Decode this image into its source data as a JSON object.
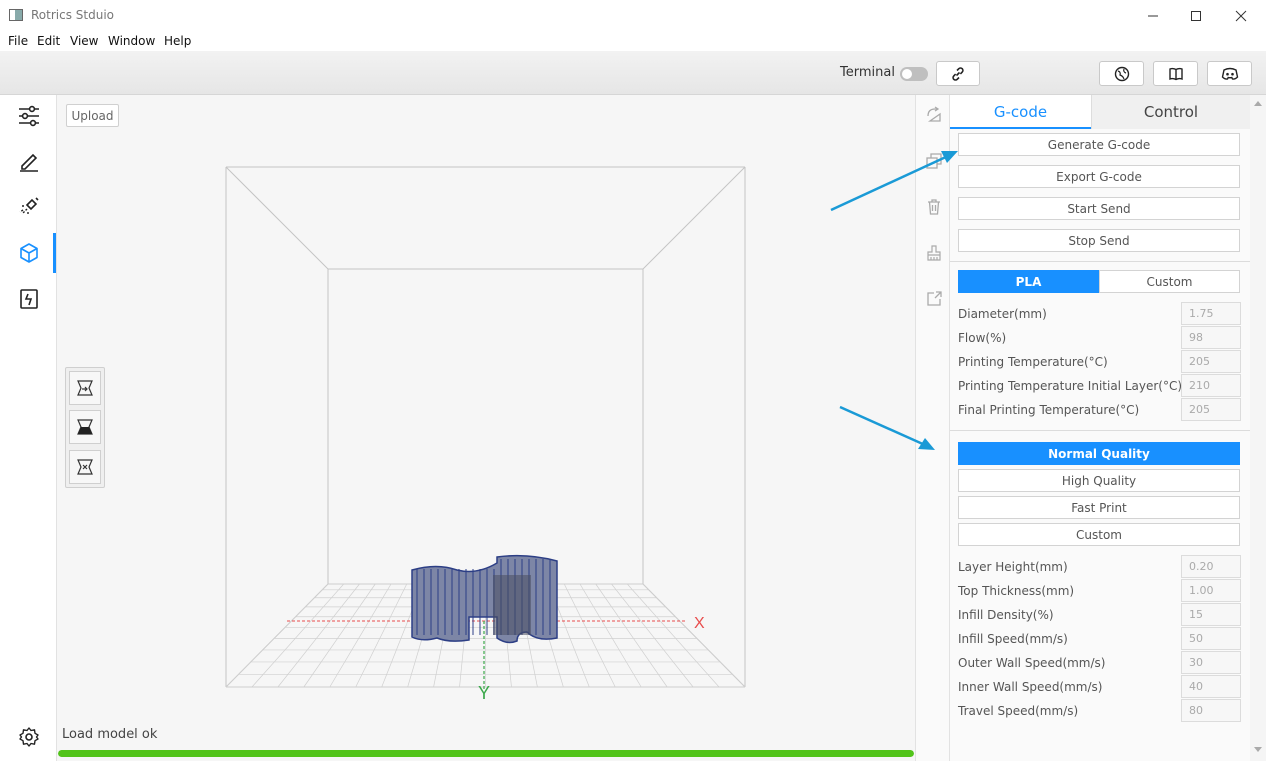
{
  "window": {
    "title": "Rotrics Stduio",
    "controls": [
      "minimize",
      "maximize",
      "close"
    ]
  },
  "menu": [
    "File",
    "Edit",
    "View",
    "Window",
    "Help"
  ],
  "toolbar": {
    "terminal_label": "Terminal",
    "terminal_on": false,
    "connect_icon": "link-icon",
    "right_icons": [
      "globe-icon",
      "book-icon",
      "discord-icon"
    ]
  },
  "sidebar": {
    "items": [
      {
        "icon": "sliders-icon",
        "active": false
      },
      {
        "icon": "pen-icon",
        "active": false
      },
      {
        "icon": "laser-icon",
        "active": false
      },
      {
        "icon": "cube-icon",
        "active": true
      },
      {
        "icon": "code-block-icon",
        "active": false
      }
    ],
    "settings_icon": "gear-icon"
  },
  "viewport": {
    "upload_label": "Upload",
    "status": "Load model ok",
    "progress": 1.0,
    "axis_x": "X",
    "axis_y": "Y",
    "view_tools": [
      "view-front-icon",
      "view-top-icon",
      "view-side-icon"
    ]
  },
  "toolstrip": [
    "rotate-icon",
    "duplicate-icon",
    "trash-icon",
    "brush-icon",
    "export-icon"
  ],
  "panel": {
    "tabs": [
      {
        "label": "G-code",
        "active": true
      },
      {
        "label": "Control",
        "active": false
      }
    ],
    "actions": [
      "Generate G-code",
      "Export G-code",
      "Start Send",
      "Stop Send"
    ],
    "material": {
      "options": [
        {
          "label": "PLA",
          "active": true
        },
        {
          "label": "Custom",
          "active": false
        }
      ],
      "params": [
        {
          "label": "Diameter(mm)",
          "value": "1.75"
        },
        {
          "label": "Flow(%)",
          "value": "98"
        },
        {
          "label": "Printing Temperature(°C)",
          "value": "205"
        },
        {
          "label": "Printing Temperature Initial Layer(°C)",
          "value": "210"
        },
        {
          "label": "Final Printing Temperature(°C)",
          "value": "205"
        }
      ]
    },
    "quality": {
      "options": [
        {
          "label": "Normal Quality",
          "active": true
        },
        {
          "label": "High Quality",
          "active": false
        },
        {
          "label": "Fast Print",
          "active": false
        },
        {
          "label": "Custom",
          "active": false
        }
      ],
      "params": [
        {
          "label": "Layer Height(mm)",
          "value": "0.20"
        },
        {
          "label": "Top Thickness(mm)",
          "value": "1.00"
        },
        {
          "label": "Infill Density(%)",
          "value": "15"
        },
        {
          "label": "Infill Speed(mm/s)",
          "value": "50"
        },
        {
          "label": "Outer Wall Speed(mm/s)",
          "value": "30"
        },
        {
          "label": "Inner Wall Speed(mm/s)",
          "value": "40"
        },
        {
          "label": "Travel Speed(mm/s)",
          "value": "80"
        }
      ]
    }
  },
  "colors": {
    "accent": "#1890ff",
    "progress": "#52c41a",
    "annotation_arrow": "#1a9ad6",
    "axis_x": "#e84c4c",
    "axis_y": "#3aa84a",
    "model": "#3b4f8f"
  }
}
